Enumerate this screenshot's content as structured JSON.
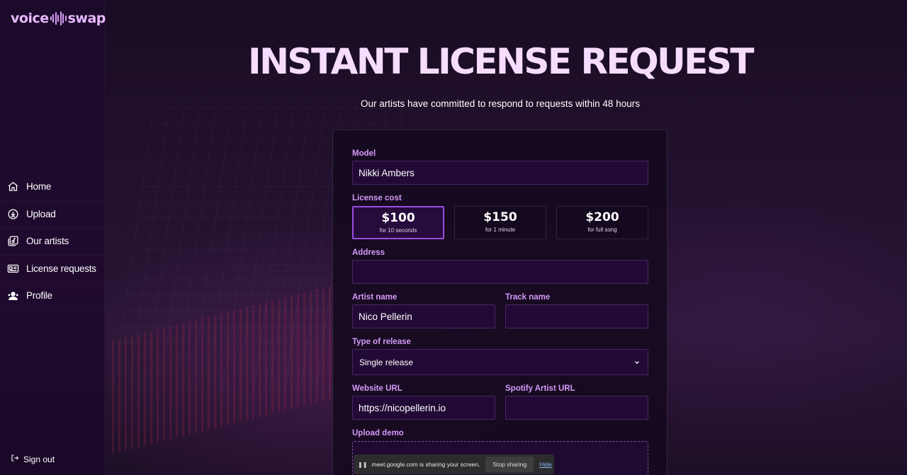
{
  "brand": {
    "left": "voice",
    "right": "swap"
  },
  "sidebar": {
    "items": [
      {
        "label": "Home",
        "icon": "home-icon"
      },
      {
        "label": "Upload",
        "icon": "upload-icon"
      },
      {
        "label": "Our artists",
        "icon": "artists-icon"
      },
      {
        "label": "License requests",
        "icon": "license-card-icon"
      },
      {
        "label": "Profile",
        "icon": "profile-icon"
      }
    ],
    "signout": "Sign out"
  },
  "page": {
    "title": "INSTANT LICENSE REQUEST",
    "subtitle": "Our artists have committed to respond to requests within 48 hours"
  },
  "form": {
    "model_label": "Model",
    "model_value": "Nikki Ambers",
    "cost_label": "License cost",
    "costs": [
      {
        "price": "$100",
        "sub": "for 10 seconds",
        "selected": true
      },
      {
        "price": "$150",
        "sub": "for 1 minute",
        "selected": false
      },
      {
        "price": "$200",
        "sub": "for full song",
        "selected": false
      }
    ],
    "address_label": "Address",
    "address_value": "",
    "artist_label": "Artist name",
    "artist_value": "Nico Pellerin",
    "track_label": "Track name",
    "track_value": "",
    "release_label": "Type of release",
    "release_value": "Single release",
    "website_label": "Website URL",
    "website_value": "https://nicopellerin.io",
    "spotify_label": "Spotify Artist URL",
    "spotify_value": "",
    "upload_label": "Upload demo"
  },
  "sharebar": {
    "message": "meet.google.com is sharing your screen.",
    "stop": "Stop sharing",
    "hide": "Hide"
  },
  "colors": {
    "accent": "#d49af7",
    "selected_border": "#9a4de0",
    "background": "#140a1e"
  }
}
